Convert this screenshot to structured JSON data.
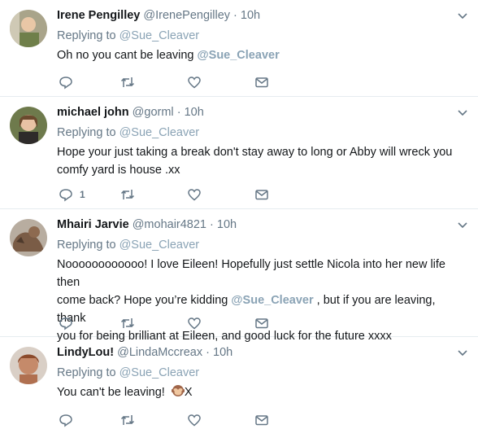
{
  "tweets": [
    {
      "name": "Irene Pengilley",
      "handle": "@IrenePengilley",
      "dot": "·",
      "time": "10h",
      "replying_label": "Replying to",
      "replying_to": "@Sue_Cleaver",
      "text_before": "Oh no you cant be leaving ",
      "text_mention": "@Sue_Cleaver",
      "text_after": "",
      "reply_count": ""
    },
    {
      "name": "michael john",
      "handle": "@gorml",
      "dot": "·",
      "time": "10h",
      "replying_label": "Replying to",
      "replying_to": "@Sue_Cleaver",
      "text_line1": "Hope your just taking a break don't stay away to long or Abby will wreck you",
      "text_line2": "comfy yard is house .xx",
      "reply_count": "1"
    },
    {
      "name": "Mhairi Jarvie",
      "handle": "@mohair4821",
      "dot": "·",
      "time": "10h",
      "replying_label": "Replying to",
      "replying_to": "@Sue_Cleaver",
      "text_line1": "Noooooooooooo! I love Eileen! Hopefully just settle Nicola into her new life then",
      "text_line2_before": "come back? Hope you’re kidding ",
      "text_line2_mention": "@Sue_Cleaver",
      "text_line2_after": " , but if you are leaving, thank",
      "text_line3": "you for being brilliant at Eileen, and good luck for the future xxxx",
      "reply_count": ""
    },
    {
      "name": "LindyLou!",
      "handle": "@LindaMccreax",
      "dot": "·",
      "time": "10h",
      "replying_label": "Replying to",
      "replying_to": "@Sue_Cleaver",
      "text_before": "You can't be leaving! ",
      "text_after": "X",
      "emoji": "see-no-evil-monkey",
      "reply_count": ""
    }
  ],
  "colors": {
    "name": "#14171a",
    "secondary": "#657786",
    "mention": "#8aa3b5",
    "divider": "#e6ecf0"
  },
  "icons": [
    "reply-icon",
    "retweet-icon",
    "like-icon",
    "direct-message-icon",
    "chevron-down-icon"
  ]
}
